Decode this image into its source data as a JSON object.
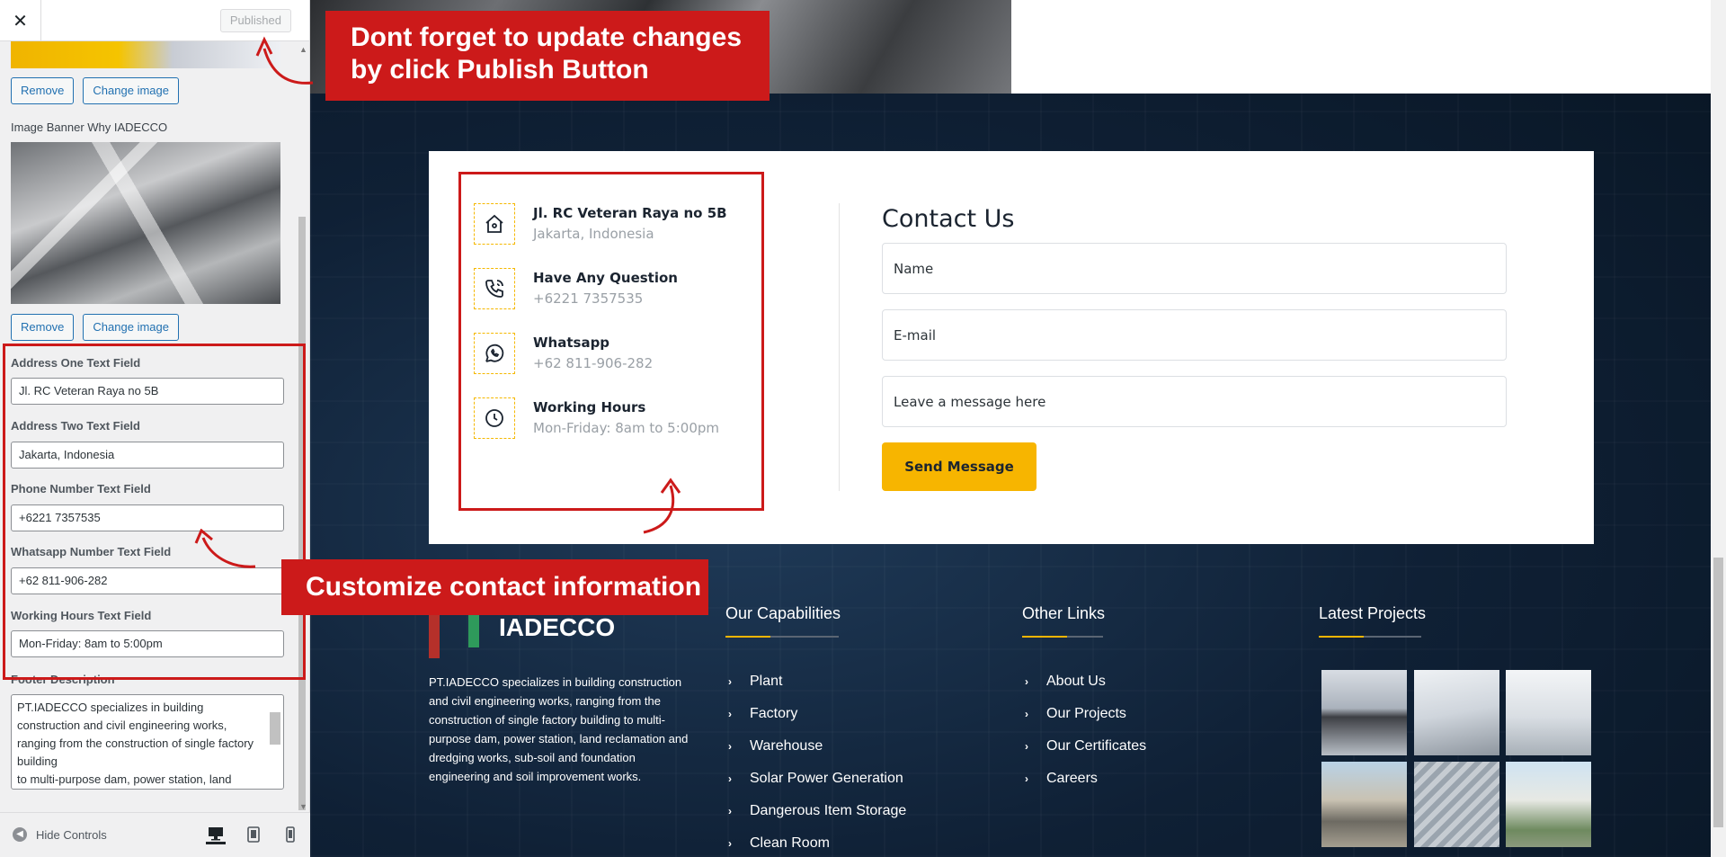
{
  "panel": {
    "close_icon": "close-icon",
    "published_label": "Published",
    "top_image": {
      "remove_label": "Remove",
      "change_label": "Change image"
    },
    "banner_label": "Image Banner Why IADECCO",
    "banner_image": {
      "remove_label": "Remove",
      "change_label": "Change image"
    },
    "fields": [
      {
        "label": "Address One Text Field",
        "value": "Jl. RC Veteran Raya no 5B"
      },
      {
        "label": "Address Two Text Field",
        "value": "Jakarta, Indonesia"
      },
      {
        "label": "Phone Number Text Field",
        "value": "+6221 7357535"
      },
      {
        "label": "Whatsapp Number Text Field",
        "value": "+62 811-906-282"
      },
      {
        "label": "Working Hours Text Field",
        "value": "Mon-Friday: 8am to 5:00pm"
      }
    ],
    "footer_label": "Footer Description",
    "footer_value": "PT.IADECCO specializes in building construction and civil engineering works, ranging from the construction of single factory building\nto multi-purpose dam, power station, land",
    "hide_controls_label": "Hide Controls",
    "devices": [
      "desktop-icon",
      "tablet-icon",
      "mobile-icon"
    ]
  },
  "annotations": {
    "publish_note": "Dont forget to update changes by click Publish Button",
    "contact_note": "Customize contact information",
    "color": "#cc1a1a"
  },
  "contact": {
    "items": [
      {
        "icon": "home-icon",
        "title": "Jl. RC Veteran Raya no 5B",
        "value": "Jakarta, Indonesia"
      },
      {
        "icon": "phone-icon",
        "title": "Have Any Question",
        "value": "+6221 7357535"
      },
      {
        "icon": "whatsapp-icon",
        "title": "Whatsapp",
        "value": "+62 811-906-282"
      },
      {
        "icon": "clock-icon",
        "title": "Working Hours",
        "value": "Mon-Friday: 8am to 5:00pm"
      }
    ],
    "title": "Contact Us",
    "name_placeholder": "Name",
    "email_placeholder": "E-mail",
    "message_placeholder": "Leave a message here",
    "send_label": "Send Message",
    "accent": "#f7b500"
  },
  "footer": {
    "brand": "IADECCO",
    "description": "PT.IADECCO specializes in building construction and civil engineering works, ranging from the construction of single factory building to multi-purpose dam, power station, land reclamation and dredging works, sub-soil and foundation engineering and soil improvement works.",
    "capabilities_title": "Our Capabilities",
    "capabilities": [
      "Plant",
      "Factory",
      "Warehouse",
      "Solar Power Generation",
      "Dangerous Item Storage",
      "Clean Room"
    ],
    "links_title": "Other Links",
    "links": [
      "About Us",
      "Our Projects",
      "Our Certificates",
      "Careers"
    ],
    "projects_title": "Latest Projects"
  }
}
